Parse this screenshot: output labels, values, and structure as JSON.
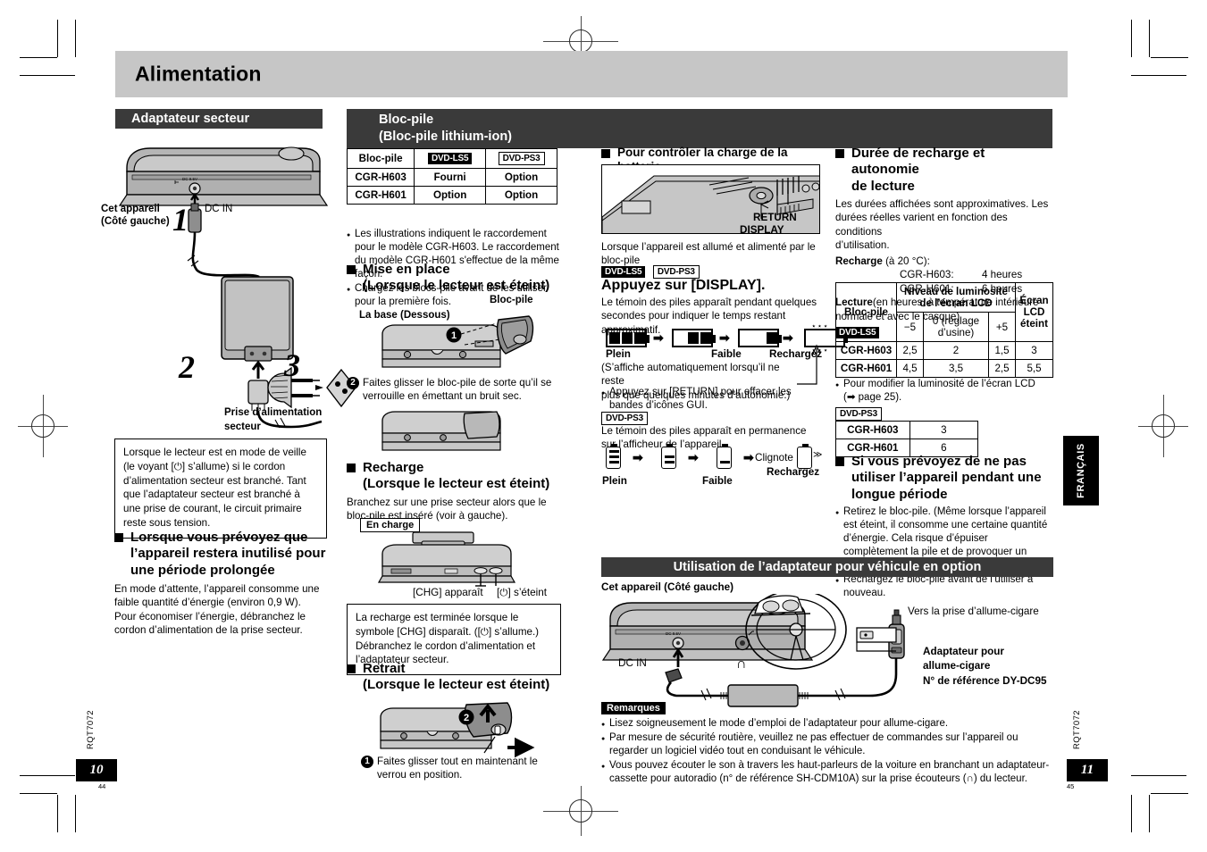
{
  "document": {
    "title": "Alimentation",
    "language_tab": "FRANÇAIS",
    "doc_code": "RQT7072"
  },
  "pages": {
    "left": {
      "number": "10",
      "sub": "44"
    },
    "right": {
      "number": "11",
      "sub": "45"
    }
  },
  "sections": {
    "ac_adapter": {
      "heading": "Adaptateur secteur"
    },
    "battery_pack": {
      "heading_line1": "Bloc-pile",
      "heading_line2": "(Bloc-pile lithium-ion)"
    },
    "car_adapter": {
      "heading": "Utilisation de l’adaptateur pour véhicule en option"
    }
  },
  "ac_adapter": {
    "label_device": "Cet appareil",
    "label_device_side": "(Côté gauche)",
    "label_dc_in": "DC IN",
    "label_outlet_l1": "Prise d’alimentation",
    "label_outlet_l2": "secteur",
    "step1": "1",
    "step2": "2",
    "step3": "3",
    "note_box": "Lorsque le lecteur est en mode de veille (le voyant [⏻] s’allume) si le cordon d’alimentation secteur est branché. Tant que l’adaptateur secteur est branché à une prise de courant, le circuit primaire reste sous tension.",
    "long_unused_heading_l1": "Lorsque vous prévoyez que",
    "long_unused_heading_l2": "l’appareil restera inutilisé pour",
    "long_unused_heading_l3": "une période prolongée",
    "long_unused_body_l1": "En mode d’attente, l’appareil consomme une",
    "long_unused_body_l2": "faible quantité d’énergie (environ 0,9 W).",
    "long_unused_body_l3": "Pour économiser l’énergie, débranchez le",
    "long_unused_body_l4": "cordon d’alimentation de la prise secteur."
  },
  "battery_table": {
    "headers": [
      "Bloc-pile",
      "DVD-LS5",
      "DVD-PS3"
    ],
    "header_chip_styles": [
      "none",
      "inverted",
      "outlined"
    ],
    "rows": [
      [
        "CGR-H603",
        "Fourni",
        "Option"
      ],
      [
        "CGR-H601",
        "Option",
        "Option"
      ]
    ],
    "notes": [
      "Les illustrations indiquent le raccordement pour le modèle CGR-H603. Le raccordement du modèle CGR-H601 s'effectue de la même façon.",
      "Chargez les blocs-pile avant de les utiliser pour la première fois."
    ]
  },
  "install": {
    "heading_l1": "Mise en place",
    "heading_l2": "(Lorsque le lecteur est éteint)",
    "label_battery": "Bloc-pile",
    "label_base": "La base (Dessous)",
    "step1": "1",
    "step2": "2",
    "step2_text": "Faites glisser le bloc-pile de sorte qu’il se verrouille en émettant un bruit sec."
  },
  "recharge": {
    "heading_l1": "Recharge",
    "heading_l2": "(Lorsque le lecteur est éteint)",
    "body_l1": "Branchez sur une prise secteur alors que le",
    "body_l2": "bloc-pile est inséré (voir à gauche).",
    "badge": "En charge",
    "label_chg": "[CHG] apparaît",
    "label_power_off": "[⏻] s’éteint",
    "note_box": "La recharge est terminée lorsque le symbole [CHG] disparaît. ([⏻] s’allume.) Débranchez le cordon d’alimentation et l’adaptateur secteur."
  },
  "removal": {
    "heading_l1": "Retrait",
    "heading_l2": "(Lorsque le lecteur est éteint)",
    "step1": "1",
    "step2": "2",
    "step1_text": "Faites glisser tout en maintenant le verrou en position."
  },
  "check_charge": {
    "heading": "Pour contrôler la charge de la batterie",
    "label_return": "RETURN",
    "label_display": "DISPLAY",
    "intro_l1": "Lorsque l’appareil est allumé et alimenté par le",
    "intro_l2": "bloc-pile",
    "chip_ls5": "DVD-LS5",
    "chip_ps3": "DVD-PS3",
    "press_display": "Appuyez sur [DISPLAY].",
    "body_l1": "Le témoin des piles apparaît pendant quelques",
    "body_l2": "secondes pour indiquer le temps restant",
    "body_l3": "approximatif.",
    "icons_full": "Plein",
    "icons_low": "Faible",
    "icons_recharge": "Rechargez",
    "auto_note_l1": "(S’affiche automatiquement lorsqu’il ne reste",
    "auto_note_l2": "plus que quelques minutes d’autonomie.)",
    "return_note": "Appuyez sur [RETURN] pour effacer les bandes d’icônes GUI.",
    "ps3_body_l1": "Le témoin des piles apparaît en permanence",
    "ps3_body_l2": "sur l’afficheur de l’appareil.",
    "ps3_full": "Plein",
    "ps3_low": "Faible",
    "ps3_blink": "Clignote",
    "ps3_recharge": "Rechargez",
    "arrow": "→"
  },
  "duration": {
    "heading_l1": "Durée de recharge et autonomie",
    "heading_l2": "de lecture",
    "intro_l1": "Les durées affichées sont approximatives. Les",
    "intro_l2": "durées réelles varient en fonction des conditions",
    "intro_l3": "d’utilisation.",
    "recharge_label": "Recharge",
    "recharge_cond": " (à 20 °C):",
    "recharge_rows": [
      {
        "model": "CGR-H603:",
        "value": "4 heures"
      },
      {
        "model": "CGR-H601:",
        "value": "6 heures"
      }
    ],
    "playback_label": "Lecture",
    "playback_cond_l1": "(en heures, à température intérieure",
    "playback_cond_l2": "normale et avec le casque)",
    "chip_ls5": "DVD-LS5",
    "chip_ps3": "DVD-PS3"
  },
  "lcd_table": {
    "col_battery": "Bloc-pile",
    "col_brightness_l1": "Niveau de luminosité",
    "col_brightness_l2": "de l’écran LCD",
    "col_lcd_off_l1": "Écran",
    "col_lcd_off_l2": "LCD",
    "col_lcd_off_l3": "éteint",
    "sub_minus5": "−5",
    "sub_zero_l1": "0 (réglage",
    "sub_zero_l2": "d’usine)",
    "sub_plus5": "+5",
    "rows": [
      [
        "CGR-H603",
        "2,5",
        "2",
        "1,5",
        "3"
      ],
      [
        "CGR-H601",
        "4,5",
        "3,5",
        "2,5",
        "5,5"
      ]
    ],
    "note_l1": "Pour modifier la luminosité de l’écran LCD",
    "note_l2": "(➡ page 25)."
  },
  "ps3_table": {
    "rows": [
      [
        "CGR-H603",
        "3"
      ],
      [
        "CGR-H601",
        "6"
      ]
    ]
  },
  "long_period": {
    "heading_l1": "Si vous prévoyez de ne pas",
    "heading_l2": "utiliser l’appareil pendant une",
    "heading_l3": "longue période",
    "notes": [
      "Retirez le bloc-pile. (Même lorsque l’appareil est éteint, il consomme une certaine quantité d’énergie. Cela risque d’épuiser complètement la pile et de provoquer un mauvais fonctionnement.)",
      "Rechargez le bloc-pile avant de l’utiliser à nouveau."
    ]
  },
  "car_adapter": {
    "label_device": "Cet appareil (Côté gauche)",
    "label_dc_in": "DC IN",
    "label_to_socket": "Vers la prise d’allume-cigare",
    "label_adapter_l1": "Adaptateur pour",
    "label_adapter_l2": "allume-cigare",
    "label_adapter_l3": "N° de référence DY-DC95",
    "remarks_title": "Remarques",
    "remarks": [
      "Lisez soigneusement le mode d’emploi de l’adaptateur pour allume-cigare.",
      "Par mesure de sécurité routière, veuillez ne pas effectuer de commandes sur l’appareil ou regarder un logiciel vidéo tout en conduisant le véhicule.",
      "Vous pouvez écouter le son à travers les haut-parleurs de la voiture en branchant un adaptateur-cassette pour autoradio (n° de référence SH-CDM10A) sur la prise écouteurs (∩) du lecteur."
    ]
  },
  "colors": {
    "banner_bg": "#c6c6c6",
    "section_bar_bg": "#3a3a3a",
    "illustration_fill": "#a8a8a8",
    "text": "#000000"
  }
}
